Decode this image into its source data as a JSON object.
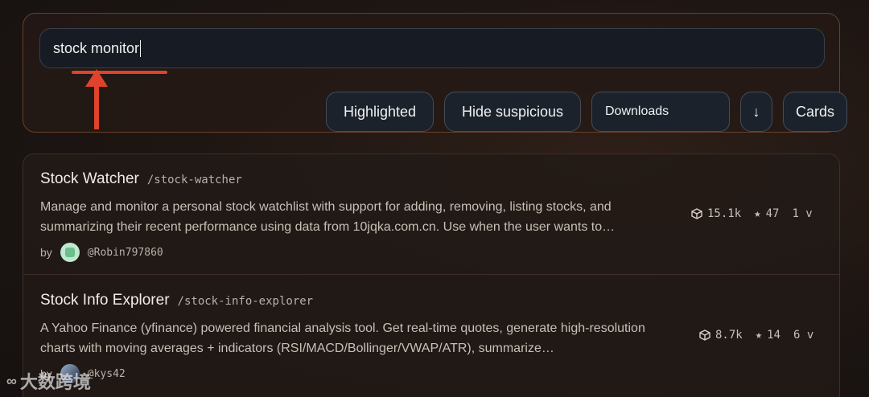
{
  "search": {
    "value": "stock monitor"
  },
  "toolbar": {
    "highlighted_label": "Highlighted",
    "hide_suspicious_label": "Hide suspicious",
    "sort_select_value": "Downloads",
    "sort_direction_glyph": "↓",
    "view_label": "Cards"
  },
  "annotation": {
    "color": "#e0432b"
  },
  "results": [
    {
      "title": "Stock Watcher",
      "slug": "/stock-watcher",
      "description": "Manage and monitor a personal stock watchlist with support for adding, removing, listing stocks, and summarizing their recent performance using data from 10jqka.com.cn. Use when the user wants to…",
      "by_label": "by",
      "author": "@Robin797860",
      "downloads": "15.1k",
      "stars": "47",
      "versions": "1 v"
    },
    {
      "title": "Stock Info Explorer",
      "slug": "/stock-info-explorer",
      "description": "A Yahoo Finance (yfinance) powered financial analysis tool. Get real-time quotes, generate high-resolution charts with moving averages + indicators (RSI/MACD/Bollinger/VWAP/ATR), summarize…",
      "by_label": "by",
      "author": "@kys42",
      "downloads": "8.7k",
      "stars": "14",
      "versions": "6 v"
    }
  ],
  "watermark": {
    "text": "大数跨境"
  }
}
